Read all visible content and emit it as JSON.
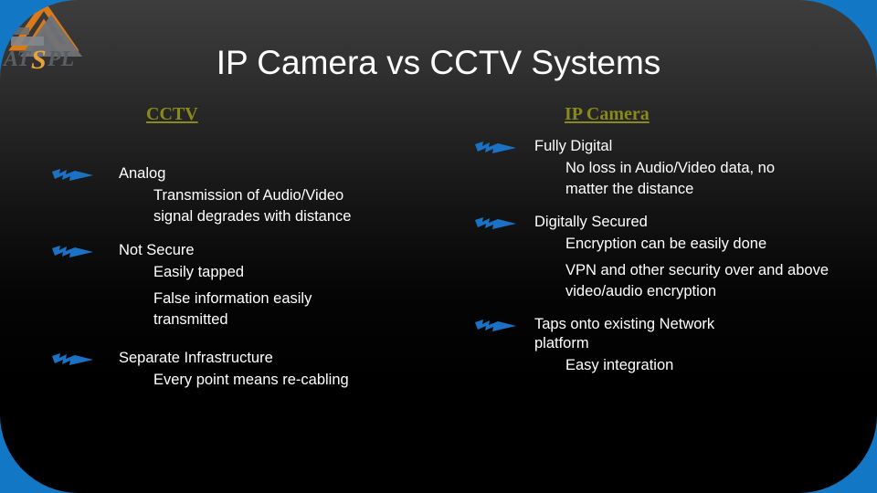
{
  "slide": {
    "title": "IP Camera vs CCTV Systems",
    "logo_text": "ATSPL",
    "colors": {
      "frame_blue": "#1277c4",
      "heading_olive": "#8a8a1b",
      "bullet_blue": "#1b72c4",
      "body_text": "#ffffff",
      "logo_orange": "#e8801a",
      "logo_gray": "#8b8e94"
    },
    "columns": [
      {
        "id": "cctv",
        "heading": "CCTV",
        "groups": [
          {
            "bullet_icon": "blue-arrow-icon",
            "lvl1": "Analog",
            "lvl2": [
              "Transmission of Audio/Video signal degrades with distance"
            ]
          },
          {
            "bullet_icon": "blue-arrow-icon",
            "lvl1": "Not Secure",
            "lvl2": [
              "Easily tapped",
              "False information easily transmitted"
            ]
          },
          {
            "bullet_icon": "blue-arrow-icon",
            "lvl1": "Separate Infrastructure",
            "lvl2": [
              "Every point means re-cabling"
            ]
          }
        ]
      },
      {
        "id": "ip-camera",
        "heading": "IP Camera",
        "groups": [
          {
            "bullet_icon": "blue-arrow-icon",
            "lvl1": "Fully Digital",
            "lvl2": [
              "No loss in Audio/Video data, no matter the distance"
            ]
          },
          {
            "bullet_icon": "blue-arrow-icon",
            "lvl1": "Digitally Secured",
            "lvl2": [
              "Encryption can be easily done",
              "VPN and other security over and above video/audio encryption"
            ]
          },
          {
            "bullet_icon": "blue-arrow-icon",
            "lvl1": "Taps onto existing Network platform",
            "lvl2": [
              "Easy integration"
            ]
          }
        ]
      }
    ]
  }
}
